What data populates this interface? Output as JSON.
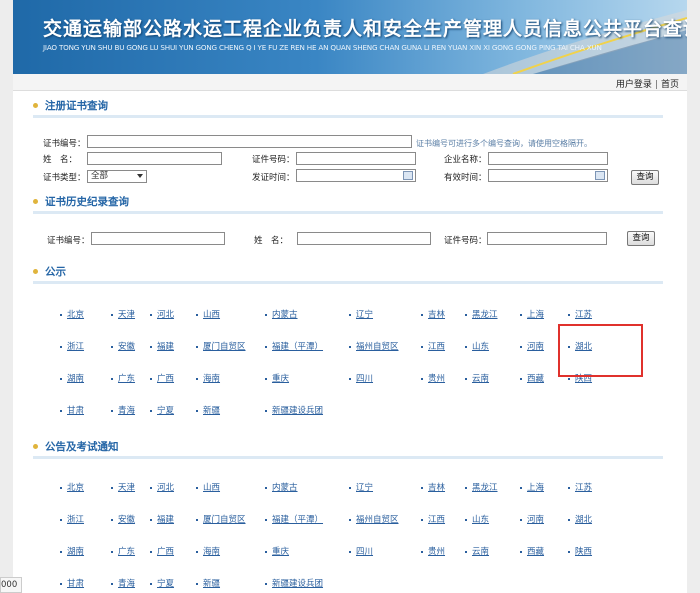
{
  "header": {
    "title": "交通运输部公路水运工程企业负责人和安全生产管理人员信息公共平台查询",
    "subtitle": "JIAO TONG YUN SHU BU GONG LU SHUI YUN GONG CHENG Q I YE FU ZE REN HE AN QUAN SHENG CHAN GUNA LI REN YUAN XIN XI GONG GONG PING TAI CHA XUN"
  },
  "toplinks": {
    "login": "用户登录",
    "sep": "|",
    "home": "首页"
  },
  "cert_query": {
    "title": "注册证书查询",
    "cert_no_label": "证书编号：",
    "hint": "证书编号可进行多个编号查询，请使用空格隔开。",
    "name_label": "姓　名：",
    "id_label": "证件号码：",
    "company_label": "企业名称：",
    "type_label": "证书类型：",
    "type_value": "全部",
    "issue_label": "发证时间：",
    "valid_label": "有效时间：",
    "button": "查询"
  },
  "history_query": {
    "title": "证书历史纪录查询",
    "cert_no_label": "证书编号：",
    "name_label": "姓　名：",
    "id_label": "证件号码：",
    "button": "查询"
  },
  "publicity": {
    "title": "公示",
    "provinces": [
      "北京",
      "天津",
      "河北",
      "山西",
      "内蒙古",
      "辽宁",
      "吉林",
      "黑龙江",
      "上海",
      "江苏",
      "浙江",
      "安徽",
      "福建",
      "厦门自贸区",
      "福建（平潭）",
      "福州自贸区",
      "江西",
      "山东",
      "河南",
      "湖北",
      "湖南",
      "广东",
      "广西",
      "海南",
      "重庆",
      "四川",
      "贵州",
      "云南",
      "西藏",
      "陕西",
      "甘肃",
      "青海",
      "宁夏",
      "新疆",
      "新疆建设兵团"
    ]
  },
  "notices": {
    "title": "公告及考试通知",
    "provinces": [
      "北京",
      "天津",
      "河北",
      "山西",
      "内蒙古",
      "辽宁",
      "吉林",
      "黑龙江",
      "上海",
      "江苏",
      "浙江",
      "安徽",
      "福建",
      "厦门自贸区",
      "福建（平潭）",
      "福州自贸区",
      "江西",
      "山东",
      "河南",
      "湖北",
      "湖南",
      "广东",
      "广西",
      "海南",
      "重庆",
      "四川",
      "贵州",
      "云南",
      "西藏",
      "陕西",
      "甘肃",
      "青海",
      "宁夏",
      "新疆",
      "新疆建设兵团"
    ]
  },
  "corner_text": "000"
}
